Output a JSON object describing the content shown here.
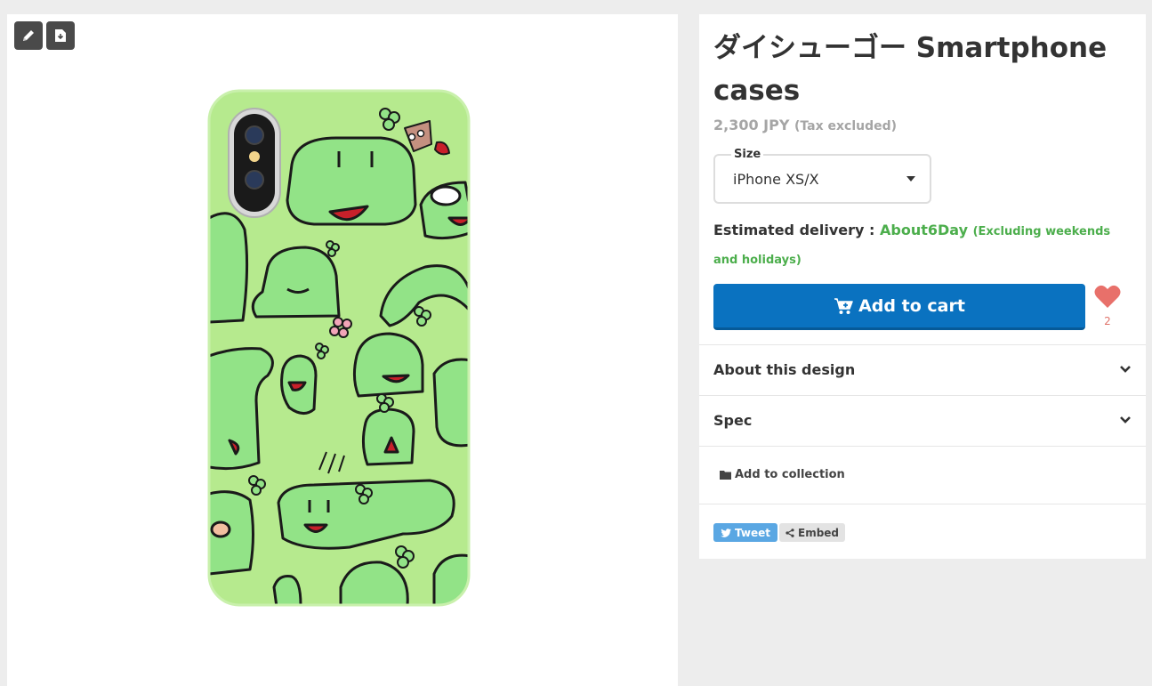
{
  "product": {
    "title": "ダイシューゴー Smartphone cases",
    "price": "2,300 JPY",
    "tax_note": "(Tax excluded)"
  },
  "size": {
    "label": "Size",
    "value": "iPhone XS/X"
  },
  "delivery": {
    "label": "Estimated delivery :",
    "value": "About6Day",
    "note": "(Excluding weekends and holidays)"
  },
  "cart": {
    "label": "Add to cart"
  },
  "favorite": {
    "count": "2"
  },
  "accordion": {
    "about_label": "About this design",
    "spec_label": "Spec"
  },
  "collection": {
    "label": "Add to collection"
  },
  "share": {
    "tweet_label": "Tweet",
    "embed_label": "Embed"
  },
  "colors": {
    "cart_button": "#0a72c0",
    "delivery_green": "#4cae4c",
    "heart": "#e8706a",
    "case_green": "#b6ea8e",
    "character_green": "#92e387"
  },
  "icons": {
    "edit": "pencil-icon",
    "download": "file-download-icon",
    "cart": "cart-plus-icon",
    "favorite": "heart-icon",
    "chevron": "chevron-down-icon",
    "collection": "folder-icon",
    "tweet": "twitter-icon",
    "embed": "share-icon"
  }
}
